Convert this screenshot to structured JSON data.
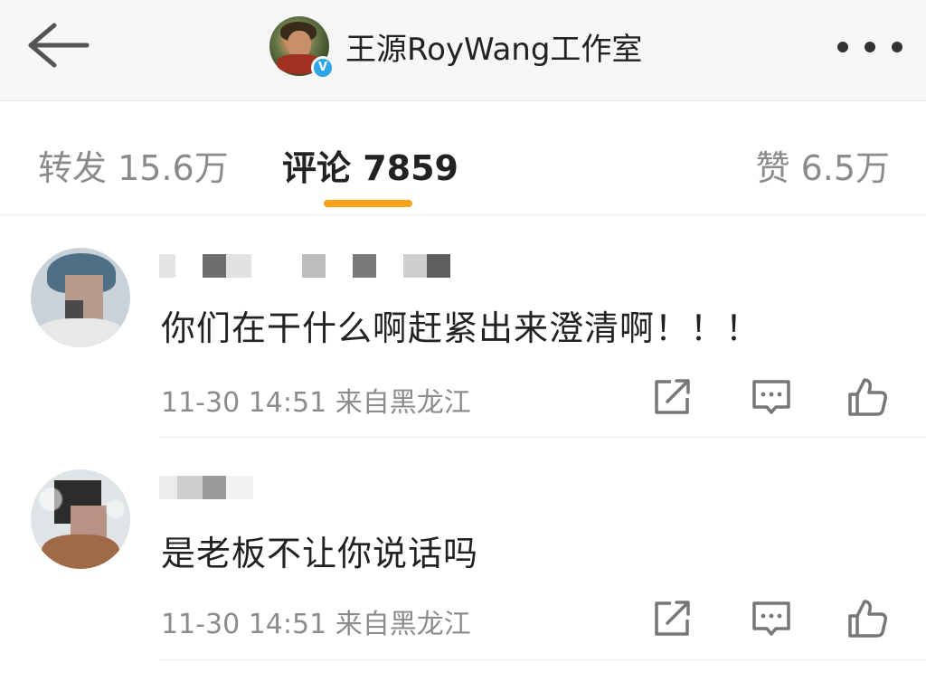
{
  "header": {
    "title": "王源RoyWang工作室",
    "back_icon": "back-arrow-icon",
    "more_icon": "more-dots-icon",
    "verified_label": "V"
  },
  "tabs": {
    "repost": "转发 15.6万",
    "comment": "评论 7859",
    "like": "赞 6.5万",
    "active": "comment",
    "accent_color": "#f7a21b"
  },
  "comments": [
    {
      "content": "你们在干什么啊赶紧出来澄清啊！！！",
      "meta": "11-30 14:51  来自黑龙江"
    },
    {
      "content": "是老板不让你说话吗",
      "meta": "11-30 14:51  来自黑龙江"
    }
  ],
  "icons": {
    "share": "share-icon",
    "reply": "comment-icon",
    "like": "thumbs-up-icon"
  }
}
